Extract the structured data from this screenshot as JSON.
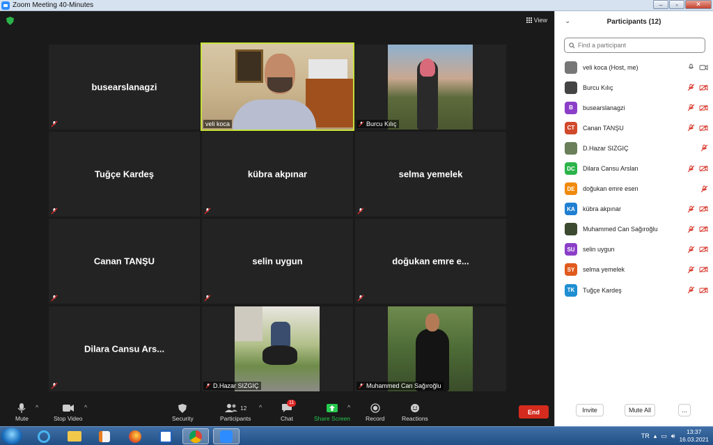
{
  "window": {
    "title": "Zoom Meeting 40-Minutes"
  },
  "top": {
    "view_label": "View"
  },
  "tiles": [
    {
      "name": "busearslanagzi"
    },
    {
      "name": "veli koca"
    },
    {
      "name": "Burcu Kılıç"
    },
    {
      "name": "Tuğçe Kardeş"
    },
    {
      "name": "kübra akpınar"
    },
    {
      "name": "selma yemelek"
    },
    {
      "name": "Canan TANŞU"
    },
    {
      "name": "selin uygun"
    },
    {
      "name": "doğukan emre e..."
    },
    {
      "name": "Dilara Cansu Ars..."
    },
    {
      "name": "D.Hazar SIZGIÇ"
    },
    {
      "name": "Muhammed Can Sağıroğlu"
    }
  ],
  "toolbar": {
    "mute": "Mute",
    "stop_video": "Stop Video",
    "security": "Security",
    "participants": "Participants",
    "participants_count": "12",
    "chat": "Chat",
    "chat_badge": "11",
    "share_screen": "Share Screen",
    "record": "Record",
    "reactions": "Reactions",
    "end": "End"
  },
  "panel": {
    "title": "Participants (12)",
    "search_placeholder": "Find a participant",
    "participants": [
      {
        "initials": "",
        "name": "veli koca (Host, me)",
        "color": "#777777",
        "photo": true
      },
      {
        "initials": "",
        "name": "Burcu Kılıç",
        "color": "#444444",
        "photo": true
      },
      {
        "initials": "B",
        "name": "busearslanagzi",
        "color": "#8b3fc8"
      },
      {
        "initials": "CT",
        "name": "Canan TANŞU",
        "color": "#d1492b"
      },
      {
        "initials": "",
        "name": "D.Hazar SIZGIÇ",
        "color": "#6b7f5a",
        "photo": true
      },
      {
        "initials": "DC",
        "name": "Dilara Cansu Arslan",
        "color": "#2bb44a"
      },
      {
        "initials": "DE",
        "name": "doğukan emre esen",
        "color": "#f08a0c"
      },
      {
        "initials": "KA",
        "name": "kübra akpınar",
        "color": "#1f7fd1"
      },
      {
        "initials": "",
        "name": "Muhammed Can Sağıroğlu",
        "color": "#3b4a30",
        "photo": true
      },
      {
        "initials": "SU",
        "name": "selin uygun",
        "color": "#8b3fc8"
      },
      {
        "initials": "SY",
        "name": "selma yemelek",
        "color": "#e05a1c"
      },
      {
        "initials": "TK",
        "name": "Tuğçe Kardeş",
        "color": "#1f8fd1"
      }
    ],
    "invite": "Invite",
    "mute_all": "Mute All",
    "more": "..."
  },
  "taskbar": {
    "lang": "TR",
    "time": "13:37",
    "date": "16.03.2021"
  }
}
